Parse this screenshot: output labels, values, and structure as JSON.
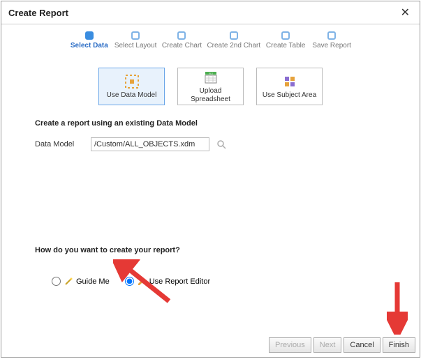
{
  "title": "Create Report",
  "steps": [
    {
      "label": "Select Data",
      "active": true
    },
    {
      "label": "Select Layout",
      "active": false
    },
    {
      "label": "Create Chart",
      "active": false
    },
    {
      "label": "Create 2nd Chart",
      "active": false
    },
    {
      "label": "Create Table",
      "active": false
    },
    {
      "label": "Save Report",
      "active": false
    }
  ],
  "cards": {
    "use_data_model": "Use Data Model",
    "upload_spreadsheet": "Upload Spreadsheet",
    "use_subject_area": "Use Subject Area"
  },
  "section_header": "Create a report using an existing Data Model",
  "data_model_label": "Data Model",
  "data_model_value": "/Custom/ALL_OBJECTS.xdm",
  "question": "How do you want to create your report?",
  "radios": {
    "guide_me": "Guide Me",
    "use_editor": "Use Report Editor"
  },
  "buttons": {
    "previous": "Previous",
    "next": "Next",
    "cancel": "Cancel",
    "finish": "Finish"
  }
}
